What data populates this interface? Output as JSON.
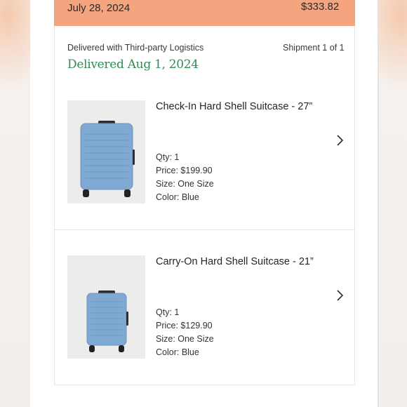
{
  "order": {
    "date": "July 28, 2024",
    "total": "$333.82",
    "banner_color": "#f4a47e"
  },
  "shipment": {
    "method": "Delivered with Third-party Logistics",
    "count": "Shipment 1 of 1",
    "status": "Delivered Aug 1, 2024",
    "status_color": "#2f8d52"
  },
  "items": [
    {
      "title": "Check-In Hard Shell Suitcase - 27”",
      "qty": "Qty: 1",
      "price": "Price: $199.90",
      "size": "Size: One Size",
      "color": "Color: Blue",
      "image_icon": "suitcase-large",
      "product_color": "#7fa8d2"
    },
    {
      "title": "Carry-On Hard Shell Suitcase - 21”",
      "qty": "Qty: 1",
      "price": "Price: $129.90",
      "size": "Size: One Size",
      "color": "Color: Blue",
      "image_icon": "suitcase-small",
      "product_color": "#7fa8d2"
    }
  ],
  "icons": {
    "item_chevron": "chevron-right-icon"
  }
}
